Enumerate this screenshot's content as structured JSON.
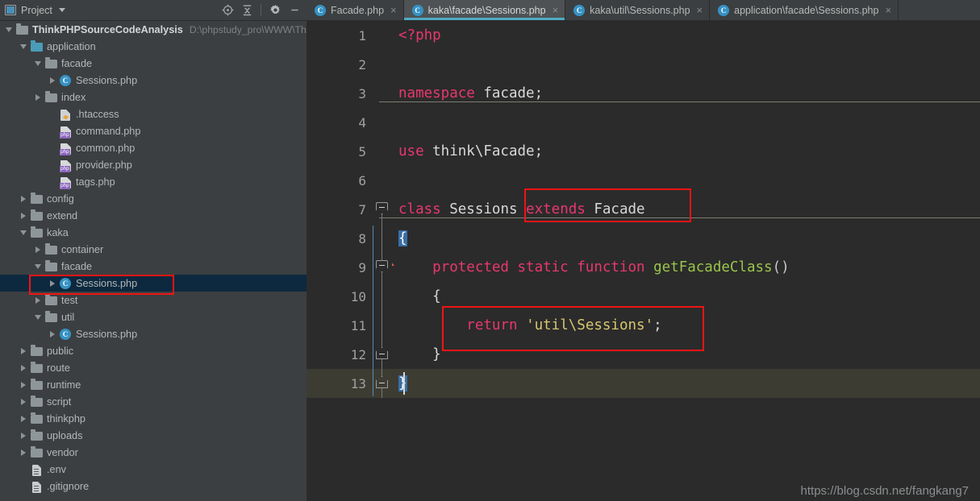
{
  "toolbar": {
    "project_label": "Project",
    "window_icon": "project-window-icon",
    "dropdown_icon": "chevron-down-icon",
    "locate_icon": "locate-target-icon",
    "collapse_icon": "collapse-all-icon",
    "settings_icon": "gear-icon",
    "hide_icon": "minimize-icon"
  },
  "tabs": [
    {
      "label": "Facade.php",
      "icon": "php-class-icon",
      "close": "×",
      "active": false
    },
    {
      "label": "kaka\\facade\\Sessions.php",
      "icon": "php-class-icon",
      "close": "×",
      "active": true
    },
    {
      "label": "kaka\\util\\Sessions.php",
      "icon": "php-class-icon",
      "close": "×",
      "active": false
    },
    {
      "label": "application\\facade\\Sessions.php",
      "icon": "php-class-icon",
      "close": "×",
      "active": false
    }
  ],
  "tree": [
    {
      "indent": 0,
      "arrow": "down",
      "icon": "folder-gray",
      "label": "ThinkPHPSourceCodeAnalysis",
      "bold": true,
      "path": "D:\\phpstudy_pro\\WWW\\Th"
    },
    {
      "indent": 1,
      "arrow": "down",
      "icon": "folder-teal",
      "label": "application"
    },
    {
      "indent": 2,
      "arrow": "down",
      "icon": "folder-gray",
      "label": "facade"
    },
    {
      "indent": 3,
      "arrow": "right",
      "icon": "php-class",
      "label": "Sessions.php"
    },
    {
      "indent": 2,
      "arrow": "right",
      "icon": "folder-gray",
      "label": "index"
    },
    {
      "indent": 3,
      "arrow": "none",
      "icon": "htaccess",
      "label": ".htaccess"
    },
    {
      "indent": 3,
      "arrow": "none",
      "icon": "php-file",
      "label": "command.php"
    },
    {
      "indent": 3,
      "arrow": "none",
      "icon": "php-file",
      "label": "common.php"
    },
    {
      "indent": 3,
      "arrow": "none",
      "icon": "php-file",
      "label": "provider.php"
    },
    {
      "indent": 3,
      "arrow": "none",
      "icon": "php-file",
      "label": "tags.php"
    },
    {
      "indent": 1,
      "arrow": "right",
      "icon": "folder-gray",
      "label": "config"
    },
    {
      "indent": 1,
      "arrow": "right",
      "icon": "folder-gray",
      "label": "extend"
    },
    {
      "indent": 1,
      "arrow": "down",
      "icon": "folder-gray",
      "label": "kaka"
    },
    {
      "indent": 2,
      "arrow": "right",
      "icon": "folder-gray",
      "label": "container"
    },
    {
      "indent": 2,
      "arrow": "down",
      "icon": "folder-gray",
      "label": "facade"
    },
    {
      "indent": 3,
      "arrow": "right",
      "icon": "php-class",
      "label": "Sessions.php",
      "selected": true,
      "highlighted": true
    },
    {
      "indent": 2,
      "arrow": "right",
      "icon": "folder-gray",
      "label": "test"
    },
    {
      "indent": 2,
      "arrow": "down",
      "icon": "folder-gray",
      "label": "util"
    },
    {
      "indent": 3,
      "arrow": "right",
      "icon": "php-class",
      "label": "Sessions.php"
    },
    {
      "indent": 1,
      "arrow": "right",
      "icon": "folder-gray",
      "label": "public"
    },
    {
      "indent": 1,
      "arrow": "right",
      "icon": "folder-gray",
      "label": "route"
    },
    {
      "indent": 1,
      "arrow": "right",
      "icon": "folder-gray",
      "label": "runtime"
    },
    {
      "indent": 1,
      "arrow": "right",
      "icon": "folder-gray",
      "label": "script"
    },
    {
      "indent": 1,
      "arrow": "right",
      "icon": "folder-gray",
      "label": "thinkphp"
    },
    {
      "indent": 1,
      "arrow": "right",
      "icon": "folder-gray",
      "label": "uploads"
    },
    {
      "indent": 1,
      "arrow": "right",
      "icon": "folder-gray",
      "label": "vendor"
    },
    {
      "indent": 1,
      "arrow": "none",
      "icon": "text-file",
      "label": ".env"
    },
    {
      "indent": 1,
      "arrow": "none",
      "icon": "text-file",
      "label": ".gitignore"
    }
  ],
  "editor": {
    "language": "php",
    "lines": [
      {
        "n": "1",
        "tokens": [
          {
            "t": "<?php",
            "c": "kw"
          }
        ]
      },
      {
        "n": "2",
        "tokens": []
      },
      {
        "n": "3",
        "tokens": [
          {
            "t": "namespace",
            "c": "kw"
          },
          {
            "t": " facade;",
            "c": "plain"
          }
        ]
      },
      {
        "n": "4",
        "tokens": []
      },
      {
        "n": "5",
        "tokens": [
          {
            "t": "use",
            "c": "kw"
          },
          {
            "t": " think\\Facade;",
            "c": "plain"
          }
        ]
      },
      {
        "n": "6",
        "tokens": []
      },
      {
        "n": "7",
        "tokens": [
          {
            "t": "class",
            "c": "kw"
          },
          {
            "t": " Sessions ",
            "c": "plain"
          },
          {
            "t": "extends",
            "c": "kw"
          },
          {
            "t": " Facade",
            "c": "plain"
          }
        ]
      },
      {
        "n": "8",
        "tokens": [
          {
            "t": "{",
            "c": "brace-hl"
          }
        ]
      },
      {
        "n": "9",
        "tokens": [
          {
            "t": "    protected static function",
            "c": "kw"
          },
          {
            "t": " ",
            "c": "plain"
          },
          {
            "t": "getFacadeClass",
            "c": "fn"
          },
          {
            "t": "()",
            "c": "paren"
          }
        ]
      },
      {
        "n": "10",
        "tokens": [
          {
            "t": "    {",
            "c": "plain"
          }
        ]
      },
      {
        "n": "11",
        "tokens": [
          {
            "t": "        return",
            "c": "kw"
          },
          {
            "t": " ",
            "c": "plain"
          },
          {
            "t": "'util\\Sessions'",
            "c": "str"
          },
          {
            "t": ";",
            "c": "plain"
          }
        ]
      },
      {
        "n": "12",
        "tokens": [
          {
            "t": "    }",
            "c": "plain"
          }
        ]
      },
      {
        "n": "13",
        "tokens": [
          {
            "t": "}",
            "c": "brace-hl"
          }
        ],
        "current": true
      }
    ],
    "gutter_markers": {
      "line": "9",
      "override_icon": "override-method-icon",
      "override_glyph": "O",
      "ascend_icon": "implements-arrow-icon"
    },
    "annotations": [
      {
        "name": "extends-facade-highlight",
        "target": "extends Facade"
      },
      {
        "name": "return-statement-highlight",
        "target": "return 'util\\Sessions';"
      }
    ]
  },
  "watermark": {
    "text": "https://blog.csdn.net/fangkang7"
  },
  "colors": {
    "accent": "#4eabc4",
    "annotation": "#f01414",
    "editor_bg": "#2b2b2b",
    "panel_bg": "#3c3f41",
    "selection": "#0d293f",
    "keyword": "#e8376f",
    "function": "#9ac44a",
    "string": "#d8c66e"
  }
}
